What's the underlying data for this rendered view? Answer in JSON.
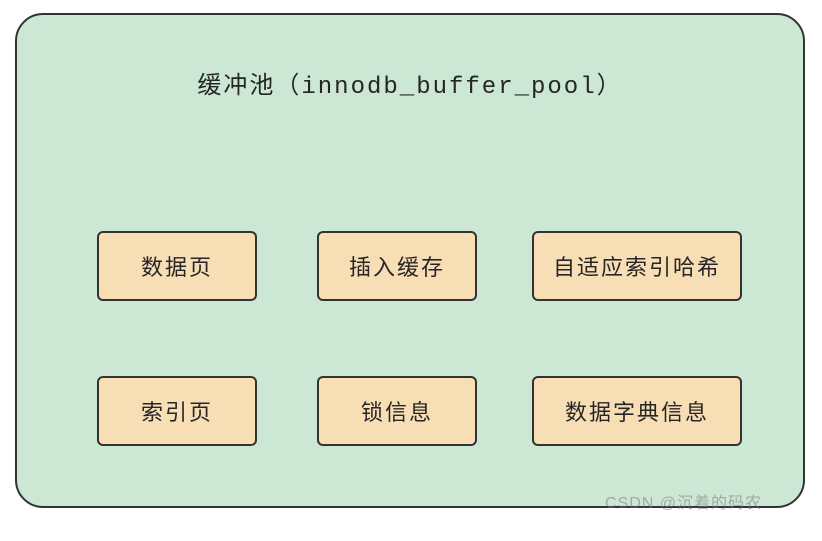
{
  "title": "缓冲池（innodb_buffer_pool）",
  "boxes": {
    "data_page": "数据页",
    "insert_cache": "插入缓存",
    "adaptive_hash": "自适应索引哈希",
    "index_page": "索引页",
    "lock_info": "锁信息",
    "dict_info": "数据字典信息"
  },
  "watermark": "CSDN @沉着的码农"
}
